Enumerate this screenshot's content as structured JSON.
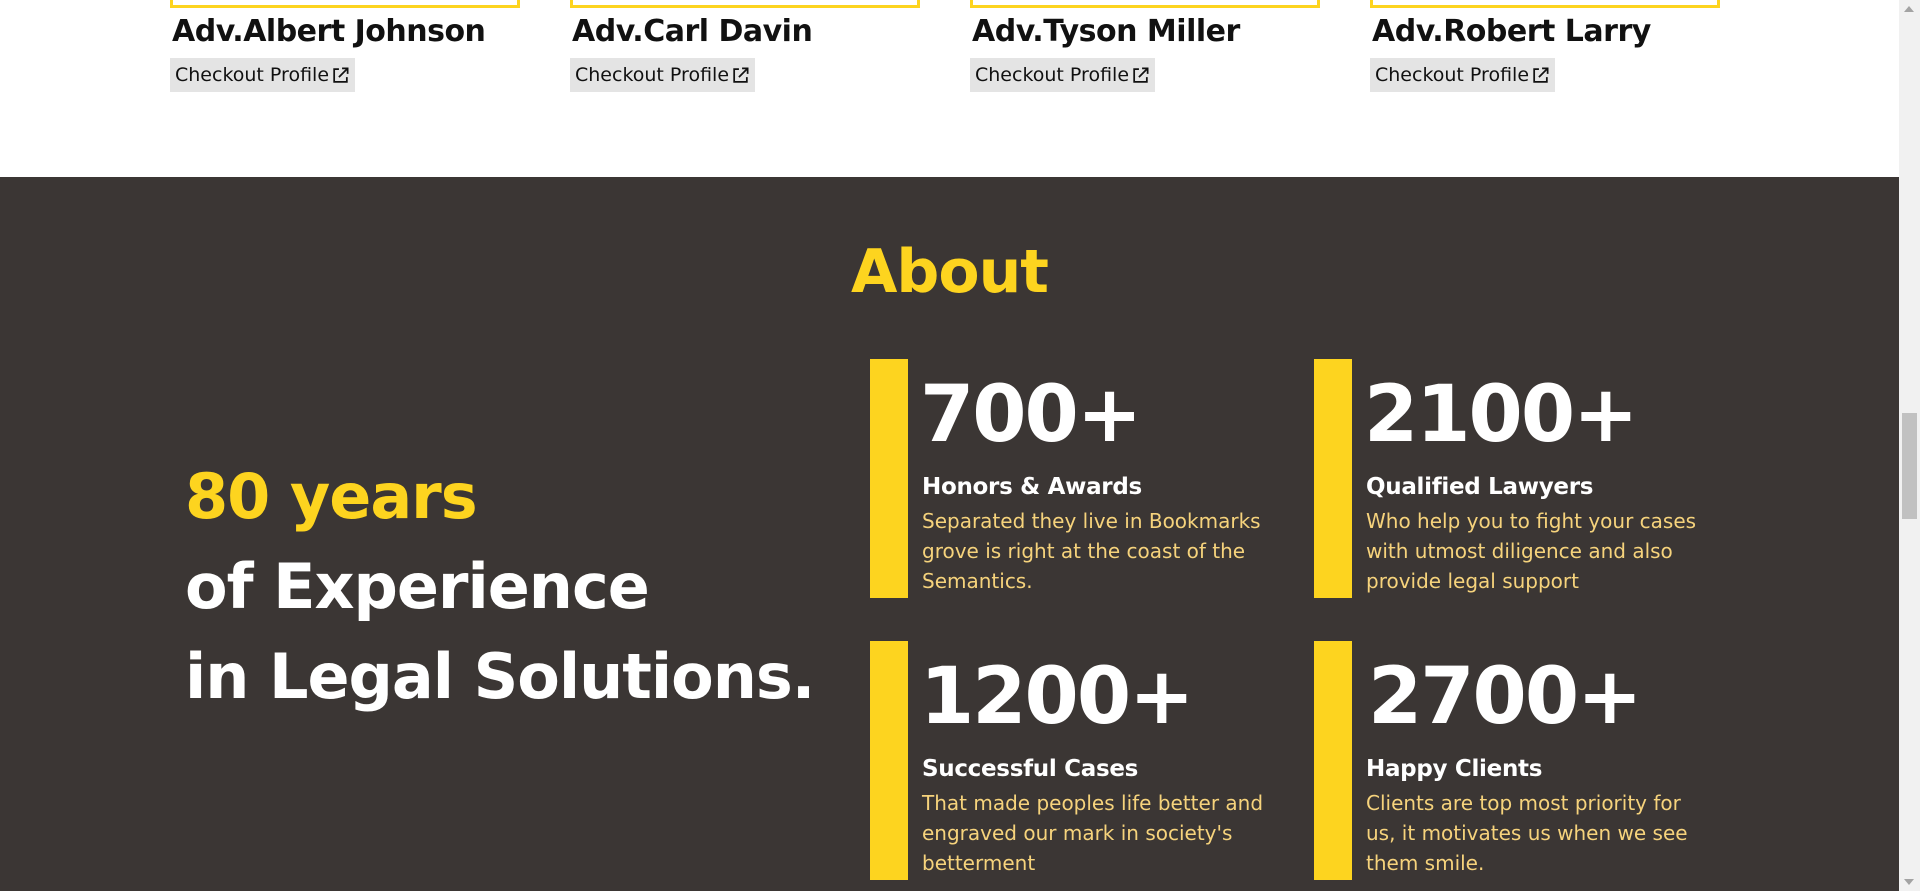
{
  "team": {
    "members": [
      {
        "name": "Adv.Albert Johnson",
        "profile_label": "Checkout Profile"
      },
      {
        "name": "Adv.Carl Davin",
        "profile_label": "Checkout Profile"
      },
      {
        "name": "Adv.Tyson Miller",
        "profile_label": "Checkout Profile"
      },
      {
        "name": "Adv.Robert Larry",
        "profile_label": "Checkout Profile"
      }
    ],
    "profile_icon": "external-link-icon"
  },
  "about": {
    "title": "About",
    "experience": {
      "years": "80 years",
      "line2": "of Experience",
      "line3": "in Legal Solutions."
    },
    "stats": [
      {
        "number": "700+",
        "label": "Honors & Awards",
        "description": "Separated they live in Bookmarks grove is right at the coast of the Semantics."
      },
      {
        "number": "2100+",
        "label": "Qualified Lawyers",
        "description": "Who help you to fight your cases with utmost diligence and also provide legal support"
      },
      {
        "number": "1200+",
        "label": "Successful Cases",
        "description": "That made peoples life better and engraved our mark in society's betterment"
      },
      {
        "number": "2700+",
        "label": "Happy Clients",
        "description": "Clients are top most priority for us, it motivates us when we see them smile."
      }
    ]
  },
  "colors": {
    "accent": "#fdd41f",
    "about_background": "#3b3634",
    "description_text": "#f6d37c",
    "button_background": "#e4e4e4"
  }
}
